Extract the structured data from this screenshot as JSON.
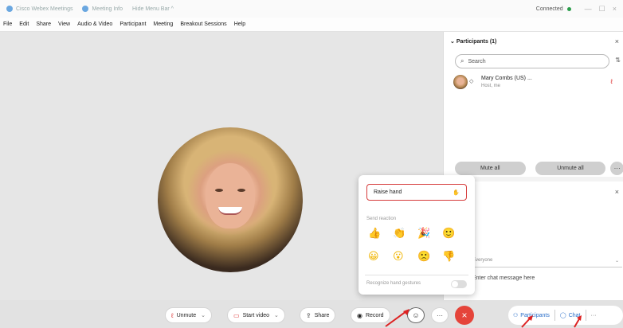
{
  "titlebar": {
    "app": "Cisco Webex Meetings",
    "meeting_info": "Meeting Info",
    "hide_menu": "Hide Menu Bar ^",
    "status": "Connected",
    "minimize": "—",
    "restore": "☐",
    "close": "×"
  },
  "menu": [
    "File",
    "Edit",
    "Share",
    "View",
    "Audio & Video",
    "Participant",
    "Meeting",
    "Breakout Sessions",
    "Help"
  ],
  "participants_panel": {
    "header": "Participants (1)",
    "search_placeholder": "Search",
    "participant": {
      "name": "Mary Combs (US) ...",
      "role": "Host, me"
    },
    "mute_all": "Mute all",
    "unmute_all": "Unmute all",
    "more": "···"
  },
  "chat_panel": {
    "to_text": "Everyone",
    "input_placeholder": "Enter chat message here"
  },
  "reaction_popup": {
    "raise_hand": "Raise hand",
    "send_reaction": "Send reaction",
    "emojis": [
      "👍",
      "👏",
      "🎉",
      "🙂",
      "😀",
      "😮",
      "🙁",
      "👎"
    ],
    "recognize_gestures": "Recognize hand gestures"
  },
  "toolbar": {
    "unmute": "Unmute",
    "start_video": "Start video",
    "share": "Share",
    "record": "Record",
    "more": "···",
    "leave": "×",
    "participants": "Participants",
    "chat": "Chat",
    "more_right": "···"
  },
  "colors": {
    "accent": "#2a6fc9",
    "leave": "#e5443a",
    "highlight": "#d63b3b",
    "connected": "#2a9d4a"
  }
}
